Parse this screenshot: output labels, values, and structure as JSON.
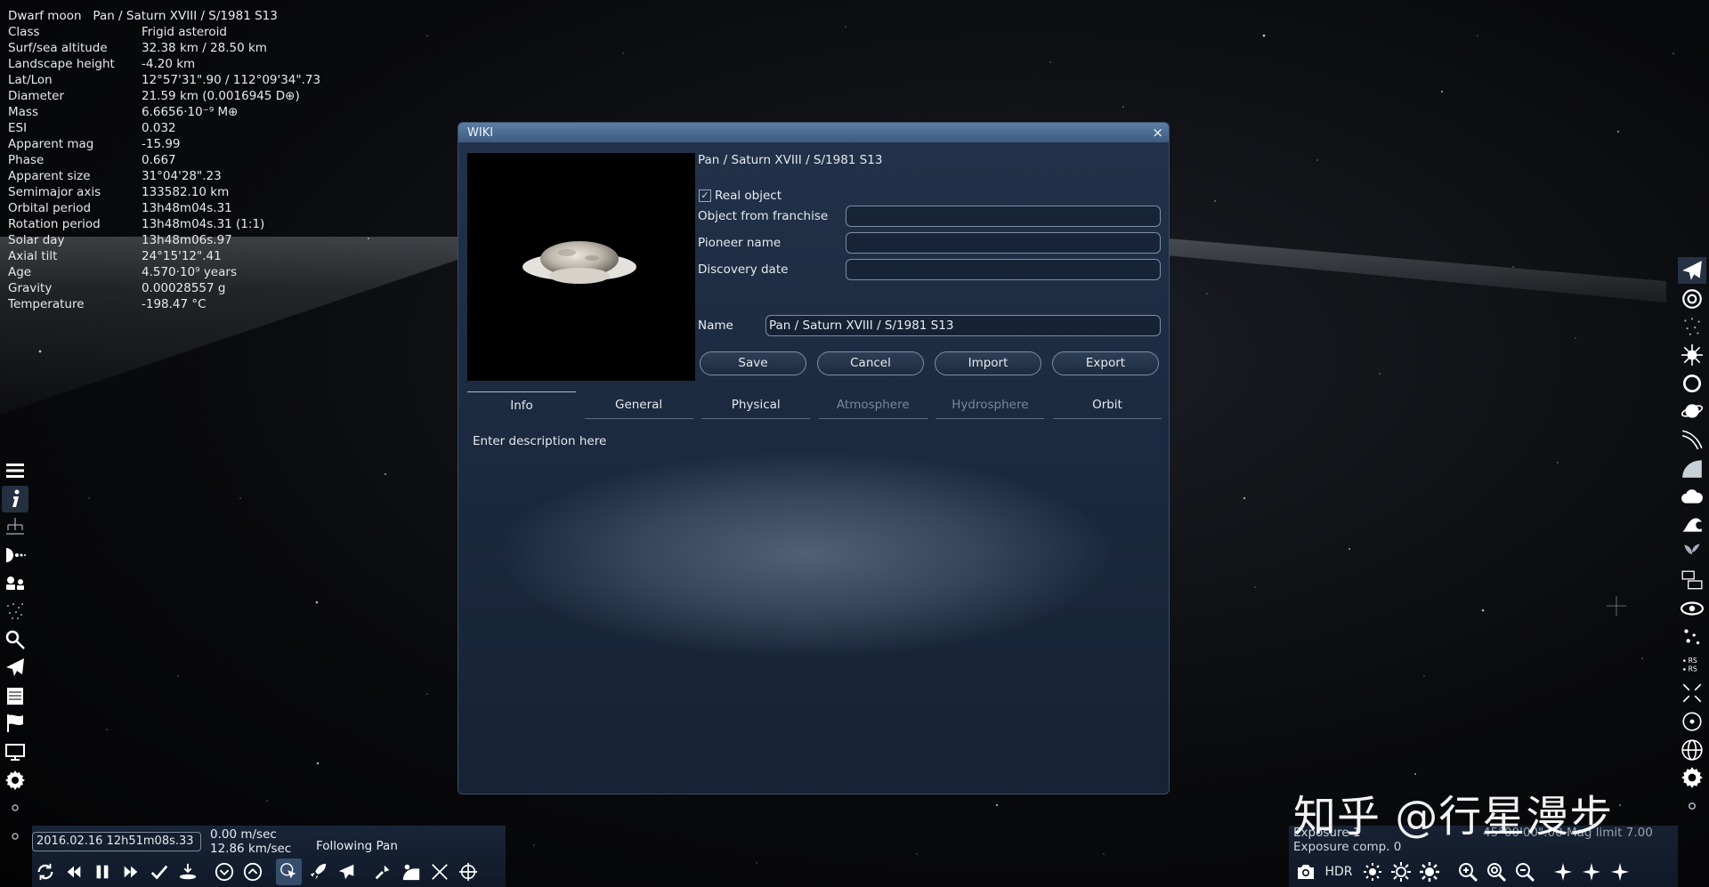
{
  "info": {
    "type": "Dwarf moon",
    "name": "Pan / Saturn XVIII / S/1981 S13",
    "rows": [
      {
        "label": "Class",
        "value": "Frigid asteroid"
      },
      {
        "label": "Surf/sea altitude",
        "value": "32.38 km / 28.50 km"
      },
      {
        "label": "Landscape height",
        "value": "-4.20 km"
      },
      {
        "label": "Lat/Lon",
        "value": "12°57'31\".90 / 112°09'34\".73"
      },
      {
        "label": "Diameter",
        "value": "21.59 km (0.0016945 D⊕)"
      },
      {
        "label": "Mass",
        "value": "6.6656·10⁻⁹ M⊕"
      },
      {
        "label": "ESI",
        "value": "0.032"
      },
      {
        "label": "Apparent mag",
        "value": "-15.99"
      },
      {
        "label": "Phase",
        "value": "0.667"
      },
      {
        "label": "Apparent size",
        "value": "31°04'28\".23"
      },
      {
        "label": "Semimajor axis",
        "value": "133582.10 km"
      },
      {
        "label": "Orbital period",
        "value": "13h48m04s.31"
      },
      {
        "label": "Rotation period",
        "value": "13h48m04s.31 (1:1)"
      },
      {
        "label": "Solar day",
        "value": "13h48m06s.97"
      },
      {
        "label": "Axial tilt",
        "value": "24°15'12\".41"
      },
      {
        "label": "Age",
        "value": "4.570·10⁹ years"
      },
      {
        "label": "Gravity",
        "value": "0.00028557 g"
      },
      {
        "label": "Temperature",
        "value": "-198.47 °C"
      }
    ]
  },
  "wiki": {
    "title": "WIKI",
    "close": "×",
    "object_name": "Pan / Saturn XVIII / S/1981 S13",
    "real_object_label": "Real object",
    "real_object_checked": "✓",
    "fields": [
      {
        "label": "Object from franchise",
        "value": ""
      },
      {
        "label": "Pioneer name",
        "value": ""
      },
      {
        "label": "Discovery date",
        "value": ""
      }
    ],
    "name_label": "Name",
    "name_value": "Pan / Saturn XVIII / S/1981 S13",
    "buttons": {
      "save": "Save",
      "cancel": "Cancel",
      "import": "Import",
      "export": "Export"
    },
    "tabs": {
      "info": "Info",
      "general": "General",
      "physical": "Physical",
      "atmosphere": "Atmosphere",
      "hydrosphere": "Hydrosphere",
      "orbit": "Orbit"
    },
    "description": "Enter description here"
  },
  "time": {
    "date": "2016.02.16 12h51m08s.33",
    "speed1": "0.00 m/sec",
    "speed2": "12.86 km/sec",
    "following": "Following Pan"
  },
  "view": {
    "exposure": "Exposure 1",
    "exposure_comp": "Exposure comp. 0",
    "fov": "45°00'00\".00 Mag limit 7.00",
    "hdr": "HDR"
  },
  "watermark": "知乎 @行星漫步",
  "colors": {
    "dialog_bg": "#1c2b41",
    "titlebar": "#4a6a90",
    "panel_bg": "#1a283e"
  }
}
